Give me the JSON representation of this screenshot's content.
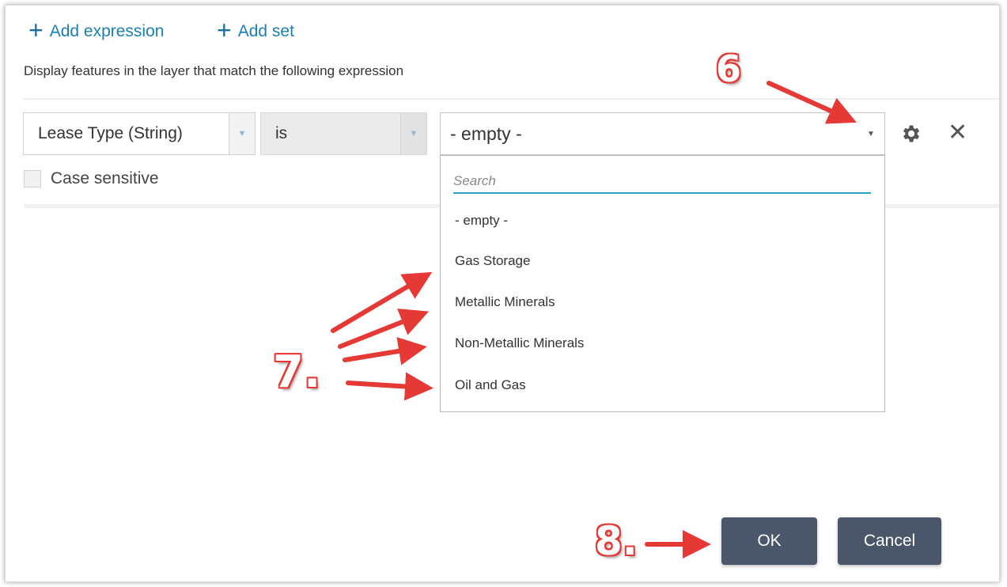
{
  "toolbar": {
    "add_expression_label": "Add expression",
    "add_set_label": "Add set",
    "add_icon": "plus-icon"
  },
  "intro_text": "Display features in the layer that match the following expression",
  "expression": {
    "field_value": "Lease Type (String)",
    "operator_value": "is",
    "value_selected": "- empty -",
    "case_sensitive_label": "Case sensitive",
    "case_sensitive_checked": false,
    "settings_icon": "gear-icon",
    "remove_icon": "close-icon"
  },
  "dropdown": {
    "search_placeholder": "Search",
    "options": [
      "- empty -",
      "Gas Storage",
      "Metallic Minerals",
      "Non-Metallic Minerals",
      "Oil and Gas"
    ]
  },
  "annotations": {
    "step6": "6",
    "step7": "7.",
    "step8": "8.",
    "color": "#e53935"
  },
  "buttons": {
    "ok_label": "OK",
    "cancel_label": "Cancel"
  },
  "colors": {
    "link": "#1a7fb5",
    "button_bg": "#4a5669",
    "search_underline": "#27a4c4"
  }
}
